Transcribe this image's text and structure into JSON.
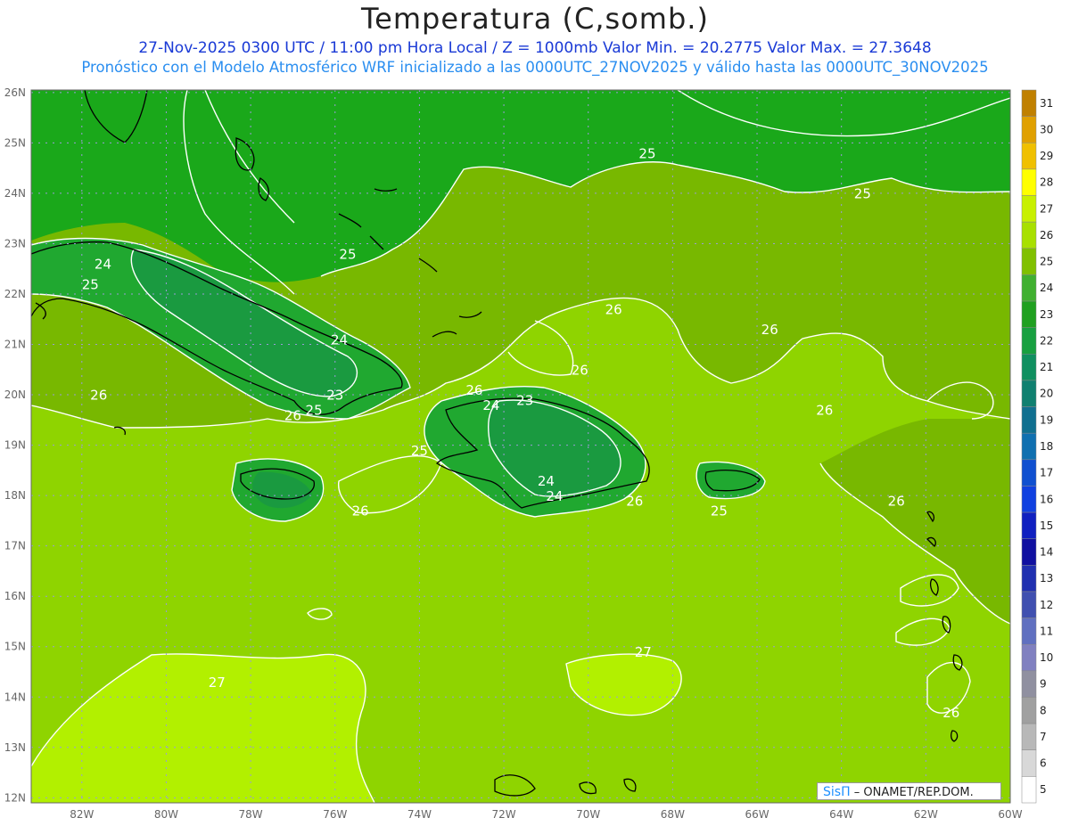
{
  "header": {
    "title": "Temperatura (C,somb.)",
    "line1": "27-Nov-2025 0300 UTC / 11:00 pm Hora Local / Z = 1000mb  Valor Min. = 20.2775  Valor Max. = 27.3648",
    "line2": "Pronóstico con el Modelo Atmosférico WRF inicializado a las 0000UTC_27NOV2025 y válido hasta las  0000UTC_30NOV2025"
  },
  "axes": {
    "lat_labels": [
      "26N",
      "25N",
      "24N",
      "23N",
      "22N",
      "21N",
      "20N",
      "19N",
      "18N",
      "17N",
      "16N",
      "15N",
      "14N",
      "13N",
      "12N"
    ],
    "lon_labels": [
      "82W",
      "80W",
      "78W",
      "76W",
      "74W",
      "72W",
      "70W",
      "68W",
      "66W",
      "64W",
      "62W",
      "60W"
    ]
  },
  "colorbar": {
    "labels": [
      "31",
      "30",
      "29",
      "28",
      "27",
      "26",
      "25",
      "24",
      "23",
      "22",
      "21",
      "20",
      "19",
      "18",
      "17",
      "16",
      "15",
      "14",
      "13",
      "12",
      "11",
      "10",
      "9",
      "8",
      "7",
      "6",
      "5"
    ],
    "colors": [
      "#c08000",
      "#e0a000",
      "#f0c000",
      "#ffff00",
      "#c8f000",
      "#a8e000",
      "#80c000",
      "#40b030",
      "#20a020",
      "#18a040",
      "#109060",
      "#108070",
      "#107090",
      "#1070b0",
      "#1050d0",
      "#1040e0",
      "#1020c0",
      "#1010a0",
      "#2030b0",
      "#4050b0",
      "#6070c0",
      "#8080c0",
      "#9090a0",
      "#a0a0a0",
      "#b8b8b8",
      "#d8d8d8",
      "#ffffff"
    ]
  },
  "contour_labels": [
    {
      "text": "25",
      "lon": -68.6,
      "lat": 24.7
    },
    {
      "text": "25",
      "lon": -63.5,
      "lat": 23.9
    },
    {
      "text": "25",
      "lon": -75.7,
      "lat": 22.7
    },
    {
      "text": "24",
      "lon": -81.5,
      "lat": 22.5
    },
    {
      "text": "25",
      "lon": -81.8,
      "lat": 22.1
    },
    {
      "text": "26",
      "lon": -69.4,
      "lat": 21.6
    },
    {
      "text": "26",
      "lon": -65.7,
      "lat": 21.2
    },
    {
      "text": "24",
      "lon": -75.9,
      "lat": 21.0
    },
    {
      "text": "26",
      "lon": -70.2,
      "lat": 20.4
    },
    {
      "text": "26",
      "lon": -72.7,
      "lat": 20.0
    },
    {
      "text": "23",
      "lon": -76.0,
      "lat": 19.9
    },
    {
      "text": "23",
      "lon": -71.5,
      "lat": 19.8
    },
    {
      "text": "24",
      "lon": -72.3,
      "lat": 19.7
    },
    {
      "text": "26",
      "lon": -81.6,
      "lat": 19.9
    },
    {
      "text": "25",
      "lon": -76.5,
      "lat": 19.6
    },
    {
      "text": "26",
      "lon": -77.0,
      "lat": 19.5
    },
    {
      "text": "26",
      "lon": -64.4,
      "lat": 19.6
    },
    {
      "text": "25",
      "lon": -74.0,
      "lat": 18.8
    },
    {
      "text": "24",
      "lon": -71.0,
      "lat": 18.2
    },
    {
      "text": "24",
      "lon": -70.8,
      "lat": 17.9
    },
    {
      "text": "26",
      "lon": -68.9,
      "lat": 17.8
    },
    {
      "text": "26",
      "lon": -75.4,
      "lat": 17.6
    },
    {
      "text": "25",
      "lon": -66.9,
      "lat": 17.6
    },
    {
      "text": "26",
      "lon": -62.7,
      "lat": 17.8
    },
    {
      "text": "27",
      "lon": -68.7,
      "lat": 14.8
    },
    {
      "text": "27",
      "lon": -78.8,
      "lat": 14.2
    },
    {
      "text": "26",
      "lon": -61.4,
      "lat": 13.6
    }
  ],
  "credit": {
    "brand": "SisΠ",
    "text": " – ONAMET/REP.DOM."
  }
}
